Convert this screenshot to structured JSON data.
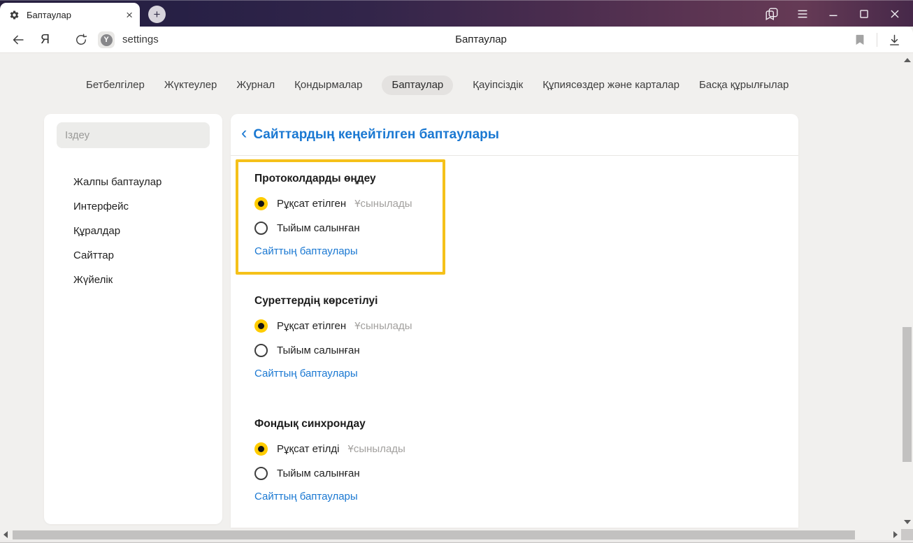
{
  "browser": {
    "tab_title": "Баптаулар",
    "new_tab_glyph": "+",
    "close_tab_glyph": "×"
  },
  "toolbar": {
    "logo_glyph": "Я",
    "favicon_glyph": "Y",
    "url_text": "settings",
    "page_title": "Баптаулар"
  },
  "nav": {
    "items": [
      {
        "label": "Бетбелгілер",
        "selected": false
      },
      {
        "label": "Жүктеулер",
        "selected": false
      },
      {
        "label": "Журнал",
        "selected": false
      },
      {
        "label": "Қондырмалар",
        "selected": false
      },
      {
        "label": "Баптаулар",
        "selected": true
      },
      {
        "label": "Қауіпсіздік",
        "selected": false
      },
      {
        "label": "Құпиясөздер және карталар",
        "selected": false
      },
      {
        "label": "Басқа құрылғылар",
        "selected": false
      }
    ]
  },
  "sidebar": {
    "search_placeholder": "Іздеу",
    "items": [
      "Жалпы баптаулар",
      "Интерфейс",
      "Құралдар",
      "Сайттар",
      "Жүйелік"
    ]
  },
  "main": {
    "back_glyph": "‹",
    "header": "Сайттардың кеңейтілген баптаулары",
    "sections": [
      {
        "title": "Протоколдарды өңдеу",
        "highlighted": true,
        "options": [
          {
            "label": "Рұқсат етілген",
            "selected": true,
            "badge": "Ұсынылады"
          },
          {
            "label": "Тыйым салынған",
            "selected": false,
            "badge": ""
          }
        ],
        "link": "Сайттың баптаулары"
      },
      {
        "title": "Суреттердің көрсетілуі",
        "highlighted": false,
        "options": [
          {
            "label": "Рұқсат етілген",
            "selected": true,
            "badge": "Ұсынылады"
          },
          {
            "label": "Тыйым салынған",
            "selected": false,
            "badge": ""
          }
        ],
        "link": "Сайттың баптаулары"
      },
      {
        "title": "Фондық синхрондау",
        "highlighted": false,
        "options": [
          {
            "label": "Рұқсат етілді",
            "selected": true,
            "badge": "Ұсынылады"
          },
          {
            "label": "Тыйым салынған",
            "selected": false,
            "badge": ""
          }
        ],
        "link": "Сайттың баптаулары"
      }
    ]
  },
  "colors": {
    "highlight_border": "#f5c11a",
    "radio_selected": "#ffcc00",
    "link_blue": "#1a78d2",
    "page_bg": "#f1f0ee",
    "tabbar_dark": "#261f3e",
    "tabbar_maroon": "#653a55"
  }
}
